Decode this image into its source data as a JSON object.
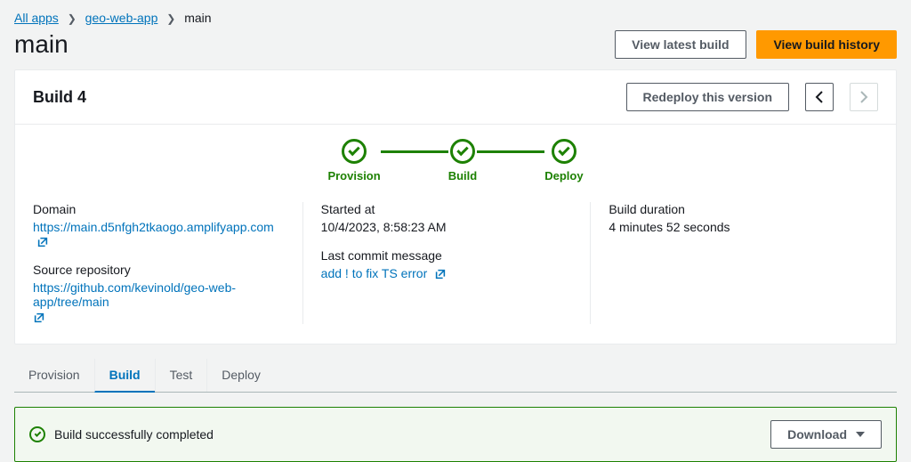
{
  "breadcrumb": {
    "all_apps": "All apps",
    "app_name": "geo-web-app",
    "branch": "main"
  },
  "page_title": "main",
  "header_buttons": {
    "view_latest": "View latest build",
    "view_history": "View build history"
  },
  "build_card": {
    "title": "Build 4",
    "redeploy": "Redeploy this version",
    "pipeline": {
      "provision": "Provision",
      "build": "Build",
      "deploy": "Deploy"
    }
  },
  "details": {
    "domain_label": "Domain",
    "domain_value": "https://main.d5nfgh2tkaogo.amplifyapp.com",
    "source_repo_label": "Source repository",
    "source_repo_value": "https://github.com/kevinold/geo-web-app/tree/main",
    "started_label": "Started at",
    "started_value": "10/4/2023, 8:58:23 AM",
    "commit_label": "Last commit message",
    "commit_value": "add ! to fix TS error",
    "duration_label": "Build duration",
    "duration_value": "4 minutes 52 seconds"
  },
  "tabs": {
    "provision": "Provision",
    "build": "Build",
    "test": "Test",
    "deploy": "Deploy"
  },
  "status": {
    "message": "Build successfully completed",
    "download": "Download"
  }
}
